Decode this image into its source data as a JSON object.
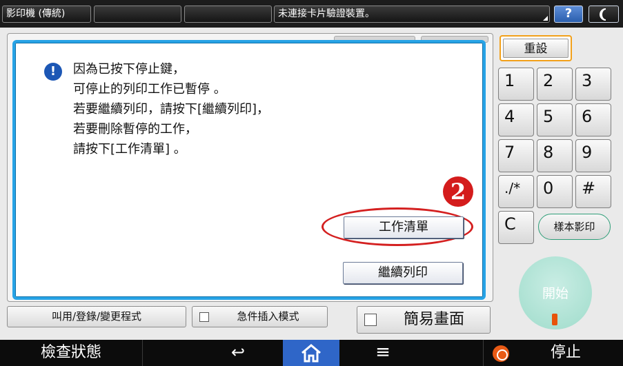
{
  "topbar": {
    "mode_title": "影印機 (傳統)",
    "status_message": "未連接卡片驗證裝置。",
    "help_label": "?",
    "energy_icon": "moon-icon"
  },
  "dialog": {
    "info_icon_glyph": "!",
    "message_lines": [
      "因為已按下停止鍵，",
      "可停止的列印工作已暫停 。",
      "若要繼續列印，請按下[繼續列印]，",
      "若要刪除暫停的工作，",
      "請按下[工作清單] 。"
    ],
    "step_badge": "2",
    "job_list_label": "工作清單",
    "continue_print_label": "繼續列印"
  },
  "functions": {
    "recall_label": "叫用/登錄/變更程式",
    "interrupt_label": "急件插入模式",
    "simple_screen_label": "簡易畫面"
  },
  "keypad": {
    "reset_label": "重設",
    "keys": [
      "1",
      "2",
      "3",
      "4",
      "5",
      "6",
      "7",
      "8",
      "9",
      "./*",
      "0",
      "#",
      "C"
    ],
    "sample_copy_label": "樣本影印",
    "start_label": "開始"
  },
  "navbar": {
    "check_status_label": "檢查狀態",
    "back_icon": "↩",
    "home_icon": "⌂",
    "menu_icon": "≡",
    "stop_label": "停止"
  },
  "colors": {
    "dialog_border": "#27a3e6",
    "step_badge": "#d41c1c",
    "reset_border": "#f2a019",
    "home_active": "#2f66c8",
    "start_button": "#9fdccb",
    "stop_icon": "#e85a15"
  }
}
